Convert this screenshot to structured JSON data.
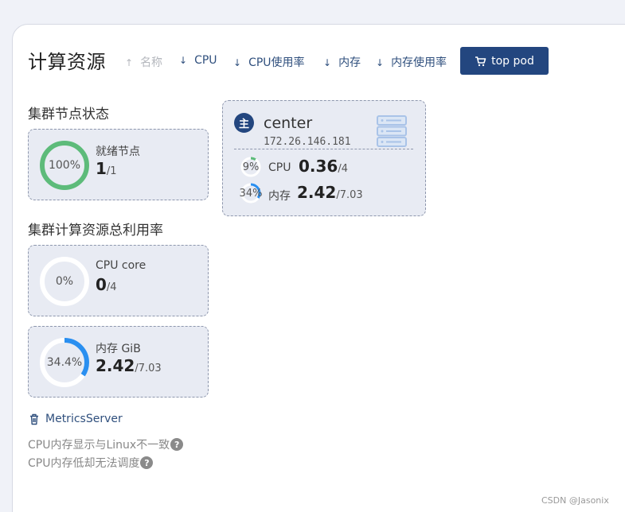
{
  "page": {
    "title": "计算资源"
  },
  "sort": [
    {
      "label": "名称",
      "arrow": "↑",
      "state": "disabled"
    },
    {
      "label": "CPU",
      "arrow": "↓",
      "state": "active"
    },
    {
      "label": "CPU使用率",
      "arrow": "↓",
      "state": "active"
    },
    {
      "label": "内存",
      "arrow": "↓",
      "state": "active"
    },
    {
      "label": "内存使用率",
      "arrow": "↓",
      "state": "active"
    }
  ],
  "top_button": {
    "label": "top pod",
    "icon": "cart-icon"
  },
  "cluster_nodes": {
    "title": "集群节点状态",
    "ready": {
      "label": "就绪节点",
      "percent_text": "100%",
      "percent": 100,
      "value": "1",
      "total": "/1",
      "color": "#5dbb7a"
    }
  },
  "cluster_usage": {
    "title": "集群计算资源总利用率",
    "cpu": {
      "label": "CPU core",
      "percent_text": "0%",
      "percent": 0,
      "value": "0",
      "total": "/4",
      "color": "#2a8ff0"
    },
    "memory": {
      "label": "内存 GiB",
      "percent_text": "34.4%",
      "percent": 34.4,
      "value": "2.42",
      "total": "/7.03",
      "color": "#2a8ff0"
    }
  },
  "node": {
    "badge": "主",
    "name": "center",
    "ip": "172.26.146.181",
    "cpu": {
      "percent_text": "9%",
      "percent": 9,
      "label": "CPU",
      "value": "0.36",
      "total": "/4",
      "color": "#5dbb7a"
    },
    "memory": {
      "percent_text": "34%",
      "percent": 34,
      "label": "内存",
      "value": "2.42",
      "total": "/7.03",
      "color": "#2a8ff0"
    }
  },
  "metrics_link": {
    "label": "MetricsServer",
    "icon": "trash-icon"
  },
  "notes": [
    {
      "text": "CPU内存显示与Linux不一致",
      "icon": "?"
    },
    {
      "text": "CPU内存低却无法调度",
      "icon": "?"
    }
  ],
  "watermark": "CSDN @Jasonix",
  "colors": {
    "primary": "#23467f",
    "card_bg": "#e8ebf3",
    "ring_track": "#ffffff",
    "green": "#5dbb7a",
    "blue": "#2a8ff0"
  }
}
